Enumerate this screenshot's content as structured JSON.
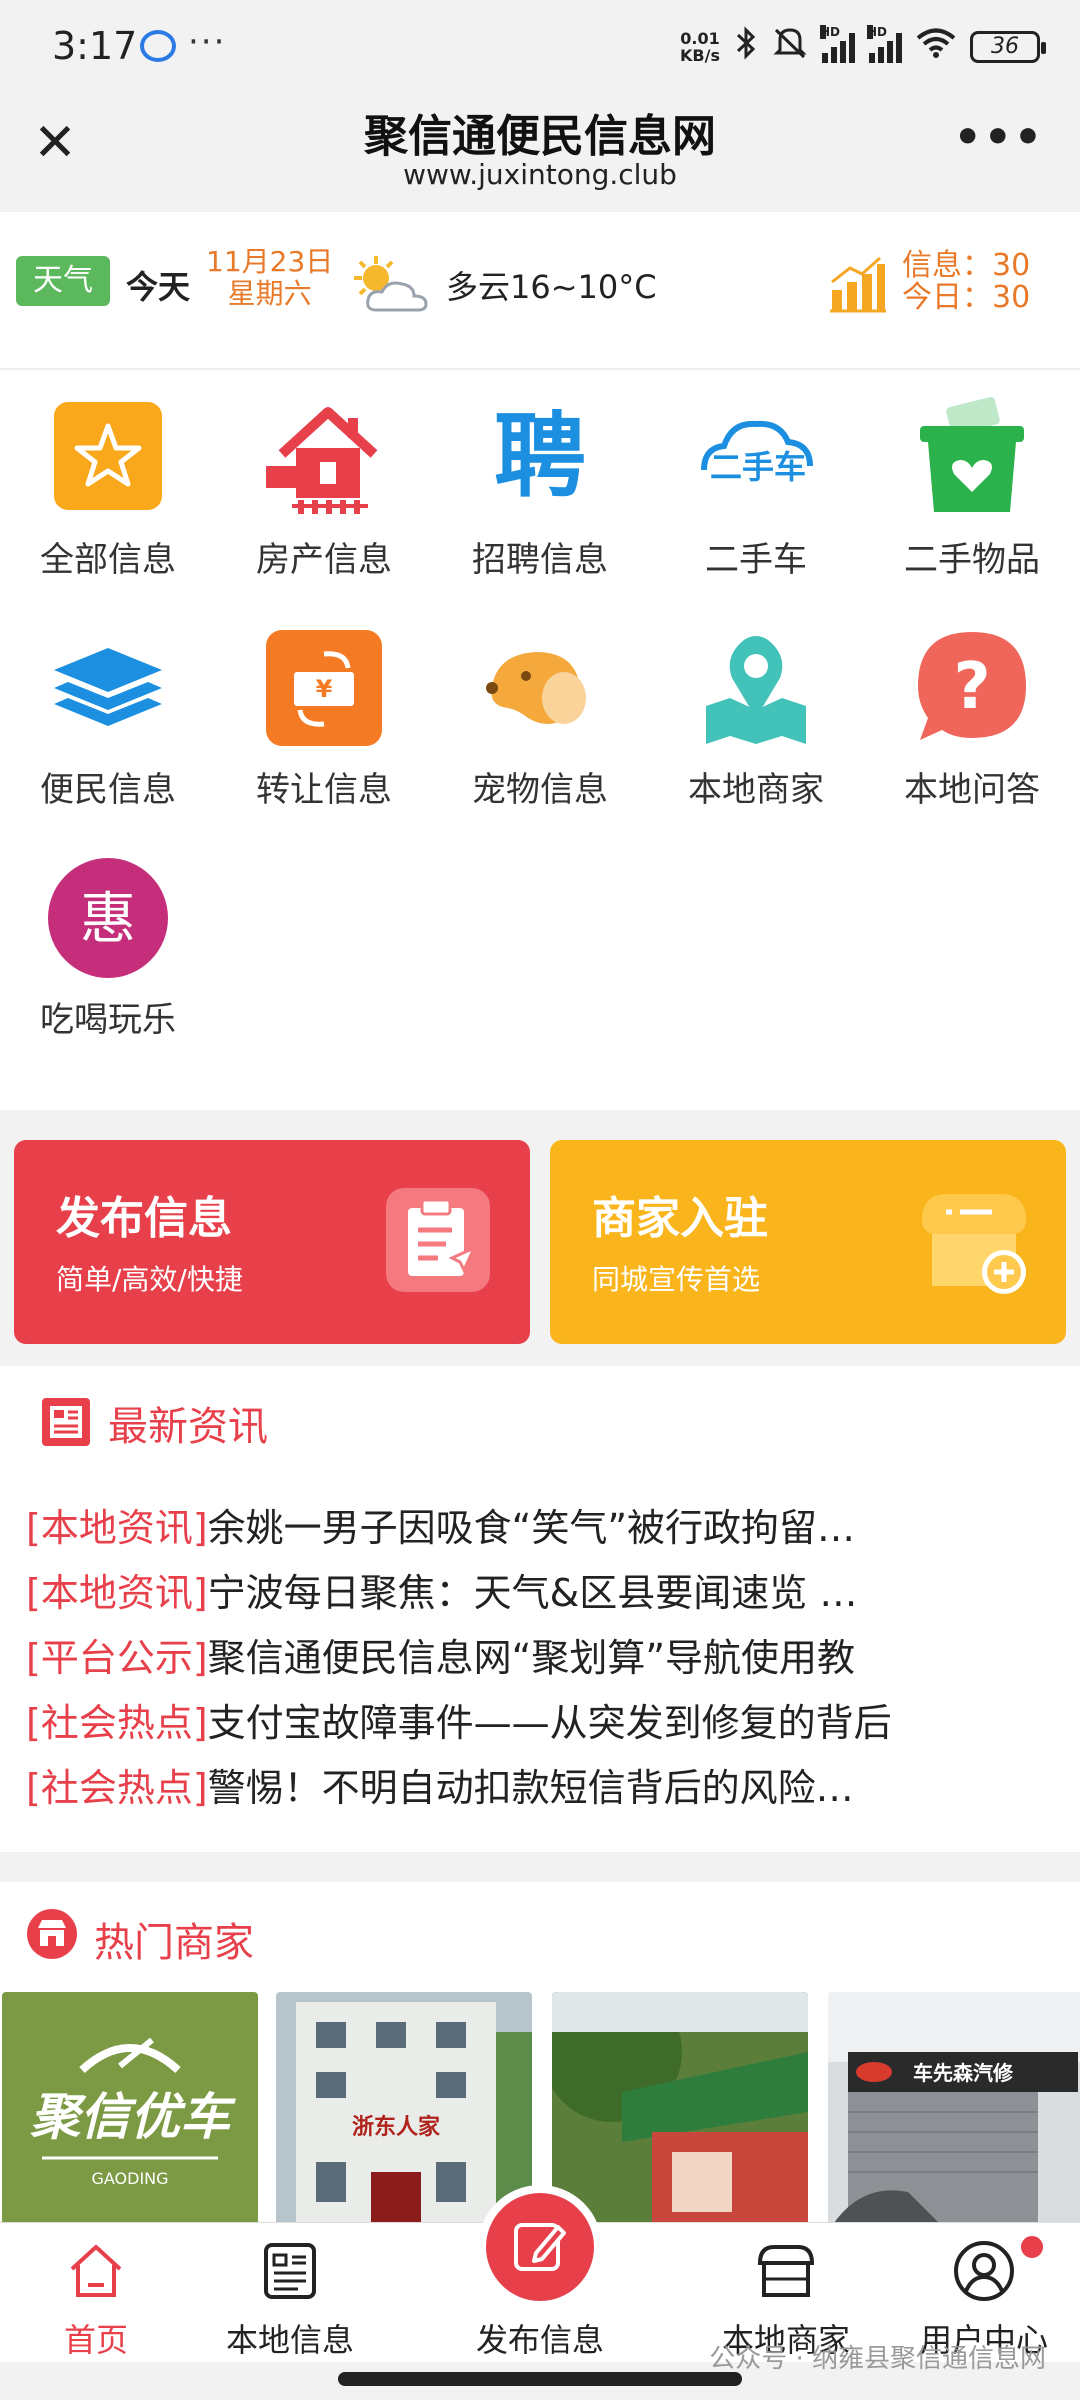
{
  "status_bar": {
    "time": "3:17",
    "dots": "···",
    "speed_top": "0.01",
    "speed_bottom": "KB/s",
    "hd1": "HD",
    "hd2": "HD",
    "battery": "36"
  },
  "header": {
    "title": "聚信通便民信息网",
    "url": "www.juxintong.club",
    "close_glyph": "✕",
    "more_glyph": "•••"
  },
  "weather": {
    "tag": "天气",
    "today": "今天",
    "date": "11月23日",
    "weekday": "星期六",
    "description": "多云16~10°C",
    "info_line": "信息：30",
    "today_line": "今日：30"
  },
  "categories": [
    {
      "label": "全部信息",
      "icon": "star-icon"
    },
    {
      "label": "房产信息",
      "icon": "house-icon"
    },
    {
      "label": "招聘信息",
      "icon": "recruit-icon"
    },
    {
      "label": "二手车",
      "icon": "used-car-icon"
    },
    {
      "label": "二手物品",
      "icon": "basket-heart-icon"
    },
    {
      "label": "便民信息",
      "icon": "layers-icon"
    },
    {
      "label": "转让信息",
      "icon": "transfer-ticket-icon"
    },
    {
      "label": "宠物信息",
      "icon": "dog-icon"
    },
    {
      "label": "本地商家",
      "icon": "map-pin-icon"
    },
    {
      "label": "本地问答",
      "icon": "question-bubble-icon"
    },
    {
      "label": "吃喝玩乐",
      "icon": "hui-badge-icon",
      "glyph": "惠"
    }
  ],
  "actions": {
    "publish": {
      "title": "发布信息",
      "subtitle": "简单/高效/快捷"
    },
    "merchant": {
      "title": "商家入驻",
      "subtitle": "同城宣传首选"
    }
  },
  "news": {
    "title": "最新资讯",
    "items": [
      {
        "tag": "[本地资讯]",
        "text": "余姚一男子因吸食“笑气”被行政拘留…"
      },
      {
        "tag": "[本地资讯]",
        "text": "宁波每日聚焦：天气&区县要闻速览 …"
      },
      {
        "tag": "[平台公示]",
        "text": "聚信通便民信息网“聚划算”导航使用教"
      },
      {
        "tag": "[社会热点]",
        "text": "支付宝故障事件——从突发到修复的背后"
      },
      {
        "tag": "[社会热点]",
        "text": "警惕！不明自动扣款短信背后的风险…"
      }
    ]
  },
  "merchants": {
    "title": "热门商家",
    "cards": [
      {
        "logo_text": "聚信优车",
        "logo_sub": "GAODING"
      },
      {
        "sign": "浙东人家"
      },
      {
        "sign": ""
      },
      {
        "sign": "车先森汽修"
      }
    ]
  },
  "bottom_nav": {
    "home": "首页",
    "local_info": "本地信息",
    "publish": "发布信息",
    "local_merchants": "本地商家",
    "user_center": "用户中心"
  },
  "watermark": "公众号 · 纳雍县聚信通信息网",
  "colors": {
    "primary_red": "#e8404b",
    "accent_orange": "#e87a2a",
    "merchant_yellow": "#fbb51c",
    "weather_green": "#5cb85c"
  }
}
